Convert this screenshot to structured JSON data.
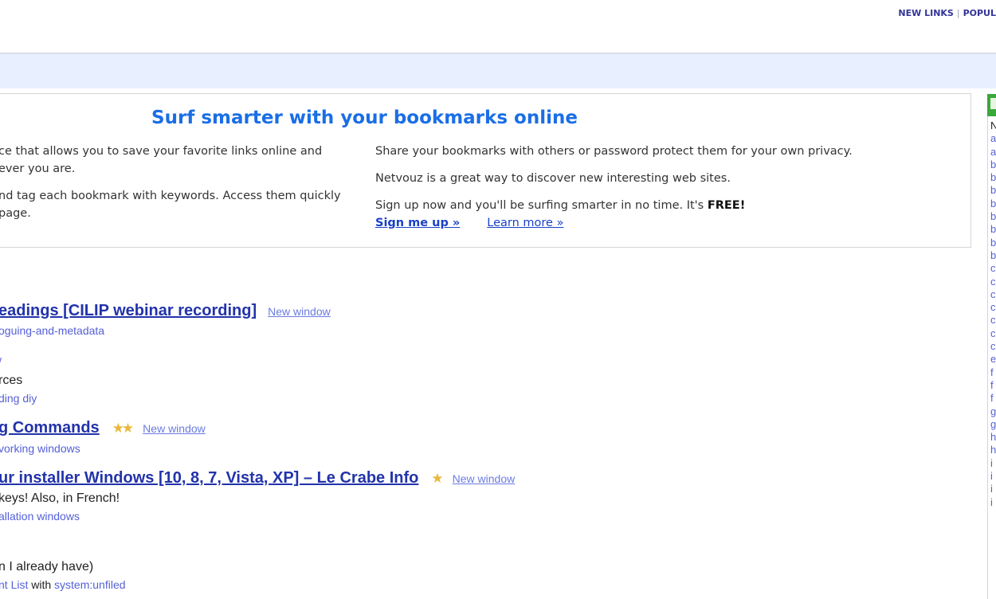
{
  "topnav": {
    "new_links": "NEW LINKS",
    "separator": "|",
    "popular": "POPUL"
  },
  "promo": {
    "title": "Surf smarter with your bookmarks online",
    "left": [
      "ce that allows you to save your favorite links online and",
      "ever you are.",
      "nd tag each bookmark with keywords. Access them quickly",
      "page."
    ],
    "right_p1": "Share your bookmarks with others or password protect them for your own privacy.",
    "right_p2": "Netvouz is a great way to discover new interesting web sites.",
    "right_p3_text": "Sign up now and you'll be surfing smarter in no time. It's ",
    "right_p3_bold": "FREE!",
    "signup": "Sign me up »",
    "learn": "Learn more »"
  },
  "bookmarks": [
    {
      "title": "eadings [CILIP webinar recording]",
      "new_window": "New window",
      "tags": "oguing-and-metadata"
    },
    {
      "tags_line1": "/",
      "desc": "rces",
      "tags": "ding diy"
    },
    {
      "title": "g Commands",
      "stars": "★★",
      "new_window": "New window",
      "tags": "vorking windows"
    },
    {
      "title": "ur installer Windows [10, 8, 7, Vista, XP] – Le Crabe Info",
      "stars": "★",
      "new_window": "New window",
      "desc": " keys! Also, in French!",
      "tags": "allation windows"
    },
    {
      "desc": "n I already have)",
      "list_link": "nt List",
      "with": " with ",
      "filed": "system:unfiled"
    }
  ],
  "rightbar": {
    "green_letter": "",
    "items": [
      "N",
      "a",
      "a",
      "b",
      "b",
      "b",
      "b",
      "b",
      "b",
      "b",
      "b",
      "c",
      "c",
      "c",
      "c",
      "c",
      "c",
      "c",
      "e",
      "f",
      "f",
      "f",
      "g",
      "g",
      "h",
      "h",
      "i",
      "i",
      "i",
      "i"
    ]
  },
  "colors": {
    "accent": "#1a6ee6",
    "link": "#2233aa",
    "tag": "#5560d8",
    "band": "#e8f0ff",
    "green": "#3aa83a",
    "star": "#e8b83a"
  }
}
